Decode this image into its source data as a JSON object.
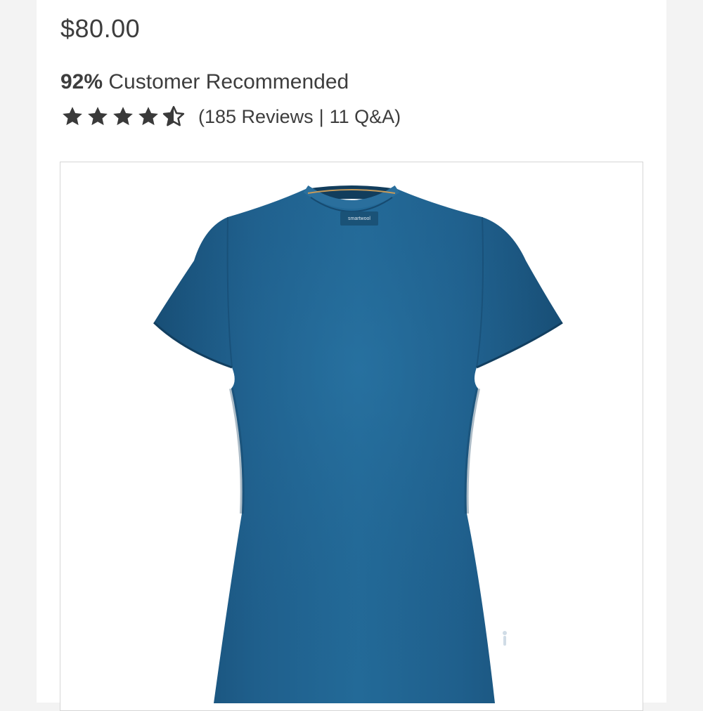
{
  "product": {
    "price": "$80.00",
    "recommend": {
      "percent": "92%",
      "label": "Customer Recommended"
    },
    "rating": {
      "value": 4.5,
      "max": 5,
      "reviews_text": "185 Reviews",
      "separator": "|",
      "qa_text": "11 Q&A"
    },
    "image": {
      "brand_label": "smartwool",
      "color": "#1f5f8c"
    }
  },
  "colors": {
    "text": "#3d3d3d",
    "star": "#3a3a3a",
    "frame_border": "#d6d6d6"
  }
}
